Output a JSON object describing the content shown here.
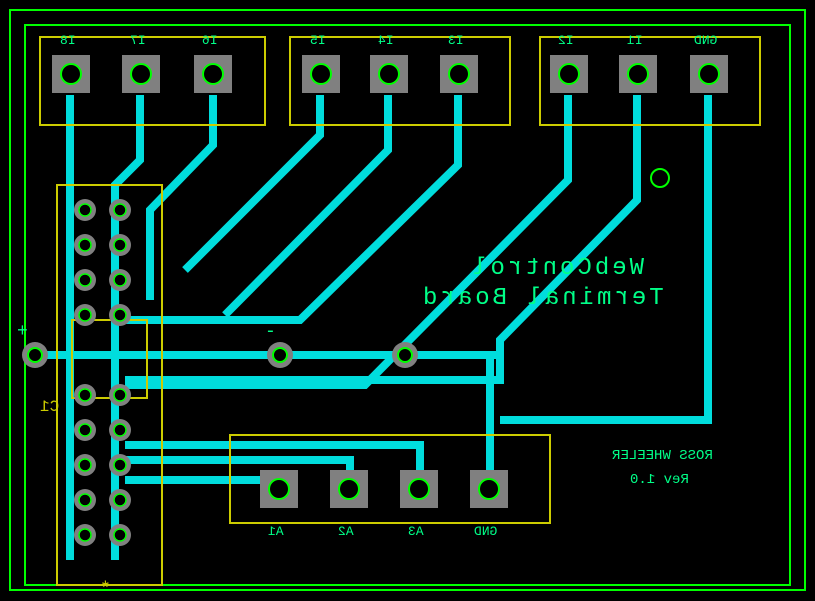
{
  "board": {
    "title_line1": "WebControl",
    "title_line2": "Terminal Board",
    "author": "ROSS WHEELER",
    "revision": "Rev 1.0"
  },
  "terminals": {
    "top_group1": [
      "I8",
      "I7",
      "I6"
    ],
    "top_group2": [
      "I5",
      "I4",
      "I3"
    ],
    "top_group3": [
      "I2",
      "I1",
      "GND"
    ],
    "bottom_group": [
      "A1",
      "A2",
      "A3",
      "GND"
    ]
  },
  "components": {
    "capacitor": "C1",
    "polarity_plus": "+",
    "polarity_minus": "-",
    "star": "*"
  },
  "colors": {
    "outline": "#00ff00",
    "silkscreen": "#00ff88",
    "copper": "#00dddd",
    "pad": "#808080",
    "hole_ring": "#00ff00",
    "box": "#cccc00"
  }
}
